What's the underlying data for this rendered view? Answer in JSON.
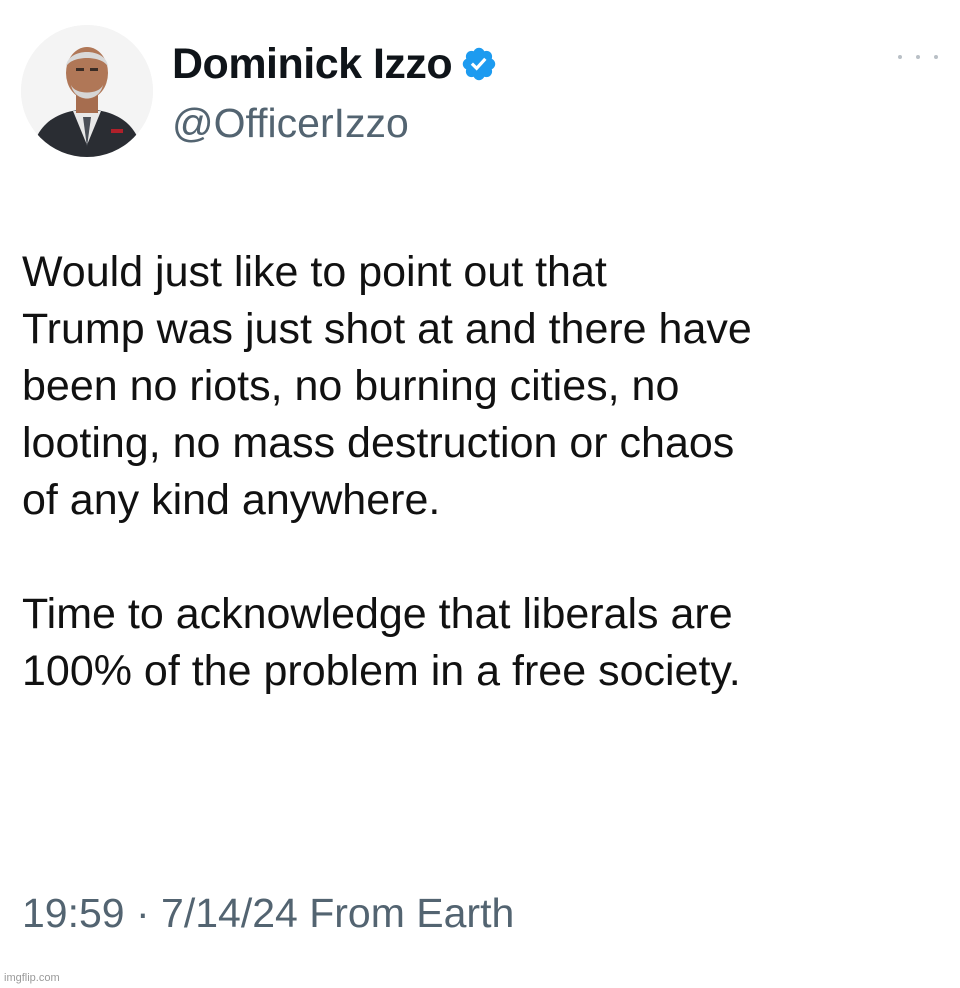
{
  "author": {
    "display_name": "Dominick Izzo",
    "handle": "@OfficerIzzo",
    "verified": true,
    "avatar_icon": "profile-photo-avatar"
  },
  "tweet": {
    "paragraph_1": [
      "Would just like to point out that",
      "Trump was just shot at and there have",
      "been no riots, no burning cities, no",
      "looting, no mass destruction or chaos",
      "of any kind anywhere."
    ],
    "paragraph_2": [
      "Time to acknowledge that liberals are",
      "100% of the problem in a free society."
    ],
    "timestamp_line": "19:59 · 7/14/24 From Earth"
  },
  "icons": {
    "verified": "verified-badge-icon",
    "more": "more-options-icon"
  },
  "colors": {
    "verified_blue": "#1d9bf0",
    "secondary_text": "#536471",
    "primary_text": "#0f1419"
  },
  "watermark": "imgflip.com"
}
